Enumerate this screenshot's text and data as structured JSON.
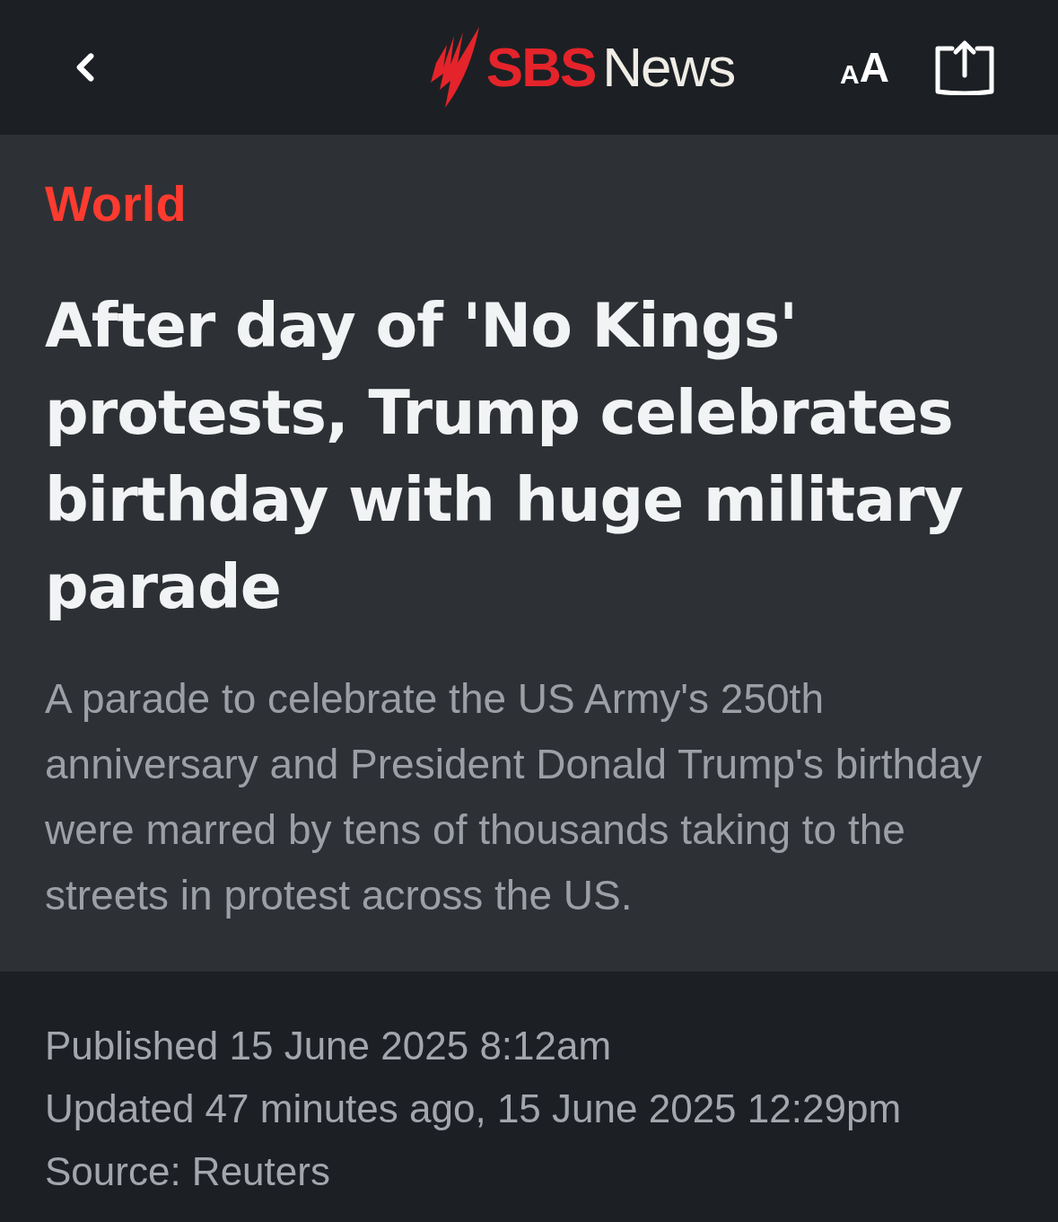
{
  "header": {
    "logo": {
      "brand": "SBS",
      "product": "News"
    },
    "text_size_button": {
      "small": "A",
      "large": "A"
    }
  },
  "article": {
    "category": "World",
    "title": "After day of 'No Kings' protests, Trump celebrates birthday with huge military parade",
    "summary": "A parade to celebrate the US Army's 250th anniversary and President Donald Trump's birthday were marred by tens of thousands taking to the streets in protest across the US."
  },
  "meta": [
    "Published 15 June 2025 8:12am",
    "Updated 47 minutes ago, 15 June 2025 12:29pm",
    "Source: Reuters"
  ]
}
